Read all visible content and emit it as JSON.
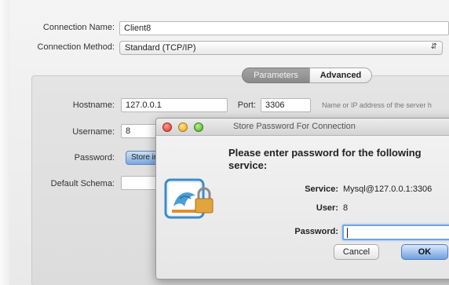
{
  "form": {
    "connection_name_label": "Connection Name:",
    "connection_name_value": "Client8",
    "connection_method_label": "Connection Method:",
    "connection_method_value": "Standard (TCP/IP)",
    "tab_parameters": "Parameters",
    "tab_advanced": "Advanced",
    "hostname_label": "Hostname:",
    "hostname_value": "127.0.0.1",
    "port_label": "Port:",
    "port_value": "3306",
    "hostname_hint": "Name or IP address of the server h",
    "username_label": "Username:",
    "username_value": "8",
    "password_label": "Password:",
    "store_button": "Store in Keychain",
    "default_schema_label": "Default Schema:"
  },
  "dialog": {
    "title": "Store Password For Connection",
    "heading": "Please enter password for the following service:",
    "service_label": "Service:",
    "service_value": "Mysql@127.0.0.1:3306",
    "user_label": "User:",
    "user_value": "8",
    "password_label": "Password:",
    "cancel_button": "Cancel",
    "ok_button": "OK"
  },
  "icons": {
    "app_icon": "mysql-workbench-icon",
    "lock_icon": "padlock-icon"
  },
  "colors": {
    "accent": "#6ea4e6",
    "close": "#d8322a",
    "minimize": "#e0a626",
    "maximize": "#4da82c"
  }
}
